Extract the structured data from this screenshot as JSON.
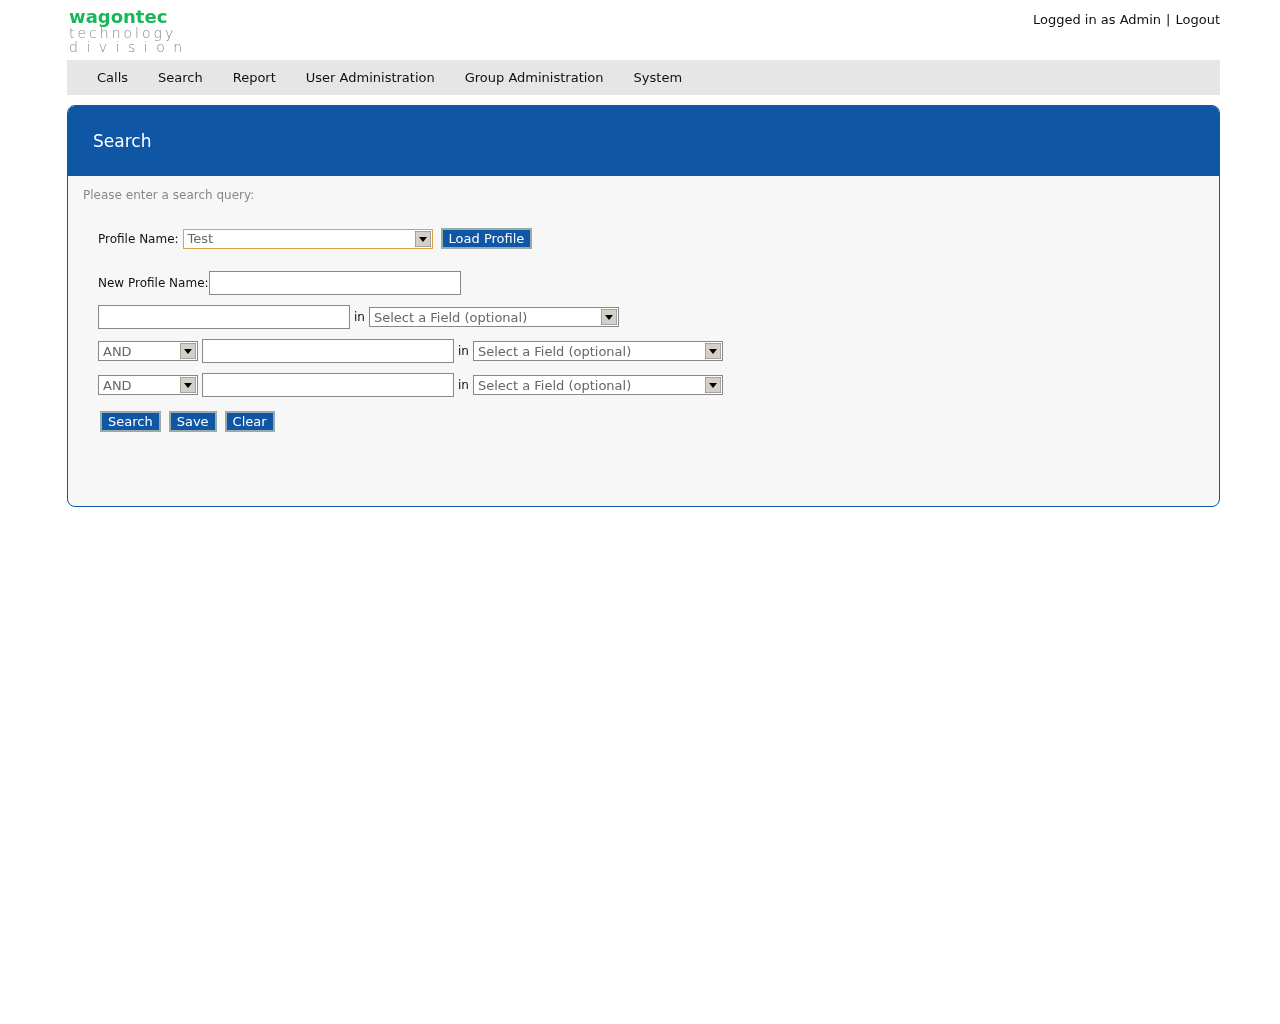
{
  "logo": {
    "brand": "wagontec",
    "line_1": "technology",
    "line_2": "division"
  },
  "user_bar": {
    "status": "Logged in as Admin",
    "separator": "|",
    "logout": "Logout"
  },
  "nav": [
    {
      "label": "Calls"
    },
    {
      "label": "Search"
    },
    {
      "label": "Report"
    },
    {
      "label": "User Administration"
    },
    {
      "label": "Group Administration"
    },
    {
      "label": "System"
    }
  ],
  "panel": {
    "title": "Search",
    "intro": "Please enter a search query:",
    "profile": {
      "label": "Profile Name:",
      "value": "Test",
      "button": "Load Profile"
    },
    "new_profile": {
      "label": "New Profile Name:"
    },
    "rows": [
      {
        "in_label": "in",
        "field": "Select a Field (optional)"
      },
      {
        "operator": "AND",
        "in_label": "in",
        "field": "Select a Field (optional)"
      },
      {
        "operator": "AND",
        "in_label": "in",
        "field": "Select a Field (optional)"
      }
    ],
    "buttons": [
      "Search",
      "Save",
      "Clear"
    ]
  }
}
